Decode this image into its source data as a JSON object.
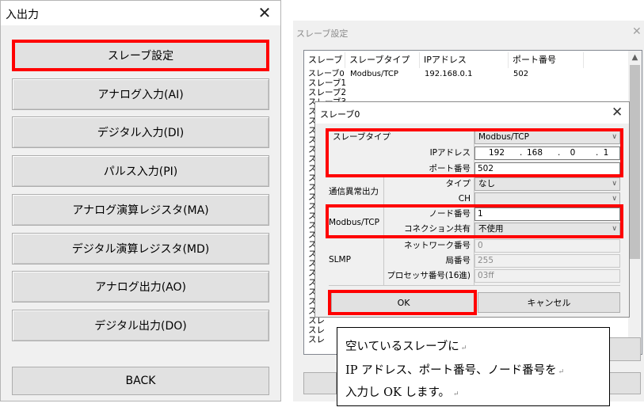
{
  "left_window": {
    "title": "入出力",
    "close": "✕",
    "buttons": [
      "スレーブ設定",
      "アナログ入力(AI)",
      "デジタル入力(DI)",
      "パルス入力(PI)",
      "アナログ演算レジスタ(MA)",
      "デジタル演算レジスタ(MD)",
      "アナログ出力(AO)",
      "デジタル出力(DO)"
    ],
    "back": "BACK"
  },
  "right_window": {
    "title": "スレーブ設定",
    "close": "✕",
    "columns": [
      "スレーブ",
      "スレーブタイプ",
      "IPアドレス",
      "ポート番号"
    ],
    "first_row": {
      "slave": "スレーブ0",
      "type": "Modbus/TCP",
      "ip": "192.168.0.1",
      "port": "502"
    },
    "row_labels": [
      "スレーブ1",
      "スレーブ2",
      "スレーブ3"
    ],
    "stub": "スレ"
  },
  "dialog": {
    "title": "スレーブ0",
    "close": "✕",
    "slave_type_label": "スレーブタイプ",
    "slave_type_value": "Modbus/TCP",
    "ip_label": "IPアドレス",
    "ip": [
      "192",
      "168",
      "0",
      "1"
    ],
    "port_label": "ポート番号",
    "port_value": "502",
    "comm_error_group": "通信異常出力",
    "type_label": "タイプ",
    "type_value": "なし",
    "ch_label": "CH",
    "modbus_group": "Modbus/TCP",
    "node_label": "ノード番号",
    "node_value": "1",
    "conn_label": "コネクション共有",
    "conn_value": "不使用",
    "slmp_group": "SLMP",
    "network_label": "ネットワーク番号",
    "network_value": "0",
    "station_label": "局番号",
    "station_value": "255",
    "processor_label": "プロセッサ番号(16進)",
    "processor_value": "03ff",
    "ok": "OK",
    "cancel": "キャンセル"
  },
  "note": {
    "line1": "空いているスレーブに",
    "line2": "IP アドレス、ポート番号、ノード番号を",
    "line3": "入力し OK します。",
    "mark": "↵"
  },
  "colors": {
    "highlight": "#ff0000"
  }
}
